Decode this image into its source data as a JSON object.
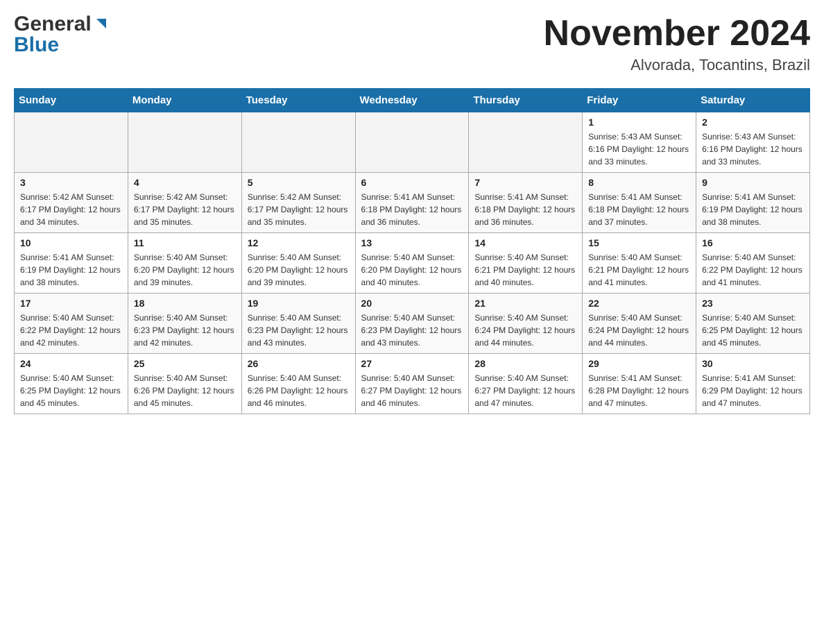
{
  "header": {
    "logo_general": "General",
    "logo_blue": "Blue",
    "month_title": "November 2024",
    "location": "Alvorada, Tocantins, Brazil"
  },
  "days_of_week": [
    "Sunday",
    "Monday",
    "Tuesday",
    "Wednesday",
    "Thursday",
    "Friday",
    "Saturday"
  ],
  "weeks": [
    {
      "days": [
        {
          "num": "",
          "info": ""
        },
        {
          "num": "",
          "info": ""
        },
        {
          "num": "",
          "info": ""
        },
        {
          "num": "",
          "info": ""
        },
        {
          "num": "",
          "info": ""
        },
        {
          "num": "1",
          "info": "Sunrise: 5:43 AM\nSunset: 6:16 PM\nDaylight: 12 hours\nand 33 minutes."
        },
        {
          "num": "2",
          "info": "Sunrise: 5:43 AM\nSunset: 6:16 PM\nDaylight: 12 hours\nand 33 minutes."
        }
      ]
    },
    {
      "days": [
        {
          "num": "3",
          "info": "Sunrise: 5:42 AM\nSunset: 6:17 PM\nDaylight: 12 hours\nand 34 minutes."
        },
        {
          "num": "4",
          "info": "Sunrise: 5:42 AM\nSunset: 6:17 PM\nDaylight: 12 hours\nand 35 minutes."
        },
        {
          "num": "5",
          "info": "Sunrise: 5:42 AM\nSunset: 6:17 PM\nDaylight: 12 hours\nand 35 minutes."
        },
        {
          "num": "6",
          "info": "Sunrise: 5:41 AM\nSunset: 6:18 PM\nDaylight: 12 hours\nand 36 minutes."
        },
        {
          "num": "7",
          "info": "Sunrise: 5:41 AM\nSunset: 6:18 PM\nDaylight: 12 hours\nand 36 minutes."
        },
        {
          "num": "8",
          "info": "Sunrise: 5:41 AM\nSunset: 6:18 PM\nDaylight: 12 hours\nand 37 minutes."
        },
        {
          "num": "9",
          "info": "Sunrise: 5:41 AM\nSunset: 6:19 PM\nDaylight: 12 hours\nand 38 minutes."
        }
      ]
    },
    {
      "days": [
        {
          "num": "10",
          "info": "Sunrise: 5:41 AM\nSunset: 6:19 PM\nDaylight: 12 hours\nand 38 minutes."
        },
        {
          "num": "11",
          "info": "Sunrise: 5:40 AM\nSunset: 6:20 PM\nDaylight: 12 hours\nand 39 minutes."
        },
        {
          "num": "12",
          "info": "Sunrise: 5:40 AM\nSunset: 6:20 PM\nDaylight: 12 hours\nand 39 minutes."
        },
        {
          "num": "13",
          "info": "Sunrise: 5:40 AM\nSunset: 6:20 PM\nDaylight: 12 hours\nand 40 minutes."
        },
        {
          "num": "14",
          "info": "Sunrise: 5:40 AM\nSunset: 6:21 PM\nDaylight: 12 hours\nand 40 minutes."
        },
        {
          "num": "15",
          "info": "Sunrise: 5:40 AM\nSunset: 6:21 PM\nDaylight: 12 hours\nand 41 minutes."
        },
        {
          "num": "16",
          "info": "Sunrise: 5:40 AM\nSunset: 6:22 PM\nDaylight: 12 hours\nand 41 minutes."
        }
      ]
    },
    {
      "days": [
        {
          "num": "17",
          "info": "Sunrise: 5:40 AM\nSunset: 6:22 PM\nDaylight: 12 hours\nand 42 minutes."
        },
        {
          "num": "18",
          "info": "Sunrise: 5:40 AM\nSunset: 6:23 PM\nDaylight: 12 hours\nand 42 minutes."
        },
        {
          "num": "19",
          "info": "Sunrise: 5:40 AM\nSunset: 6:23 PM\nDaylight: 12 hours\nand 43 minutes."
        },
        {
          "num": "20",
          "info": "Sunrise: 5:40 AM\nSunset: 6:23 PM\nDaylight: 12 hours\nand 43 minutes."
        },
        {
          "num": "21",
          "info": "Sunrise: 5:40 AM\nSunset: 6:24 PM\nDaylight: 12 hours\nand 44 minutes."
        },
        {
          "num": "22",
          "info": "Sunrise: 5:40 AM\nSunset: 6:24 PM\nDaylight: 12 hours\nand 44 minutes."
        },
        {
          "num": "23",
          "info": "Sunrise: 5:40 AM\nSunset: 6:25 PM\nDaylight: 12 hours\nand 45 minutes."
        }
      ]
    },
    {
      "days": [
        {
          "num": "24",
          "info": "Sunrise: 5:40 AM\nSunset: 6:25 PM\nDaylight: 12 hours\nand 45 minutes."
        },
        {
          "num": "25",
          "info": "Sunrise: 5:40 AM\nSunset: 6:26 PM\nDaylight: 12 hours\nand 45 minutes."
        },
        {
          "num": "26",
          "info": "Sunrise: 5:40 AM\nSunset: 6:26 PM\nDaylight: 12 hours\nand 46 minutes."
        },
        {
          "num": "27",
          "info": "Sunrise: 5:40 AM\nSunset: 6:27 PM\nDaylight: 12 hours\nand 46 minutes."
        },
        {
          "num": "28",
          "info": "Sunrise: 5:40 AM\nSunset: 6:27 PM\nDaylight: 12 hours\nand 47 minutes."
        },
        {
          "num": "29",
          "info": "Sunrise: 5:41 AM\nSunset: 6:28 PM\nDaylight: 12 hours\nand 47 minutes."
        },
        {
          "num": "30",
          "info": "Sunrise: 5:41 AM\nSunset: 6:29 PM\nDaylight: 12 hours\nand 47 minutes."
        }
      ]
    }
  ]
}
